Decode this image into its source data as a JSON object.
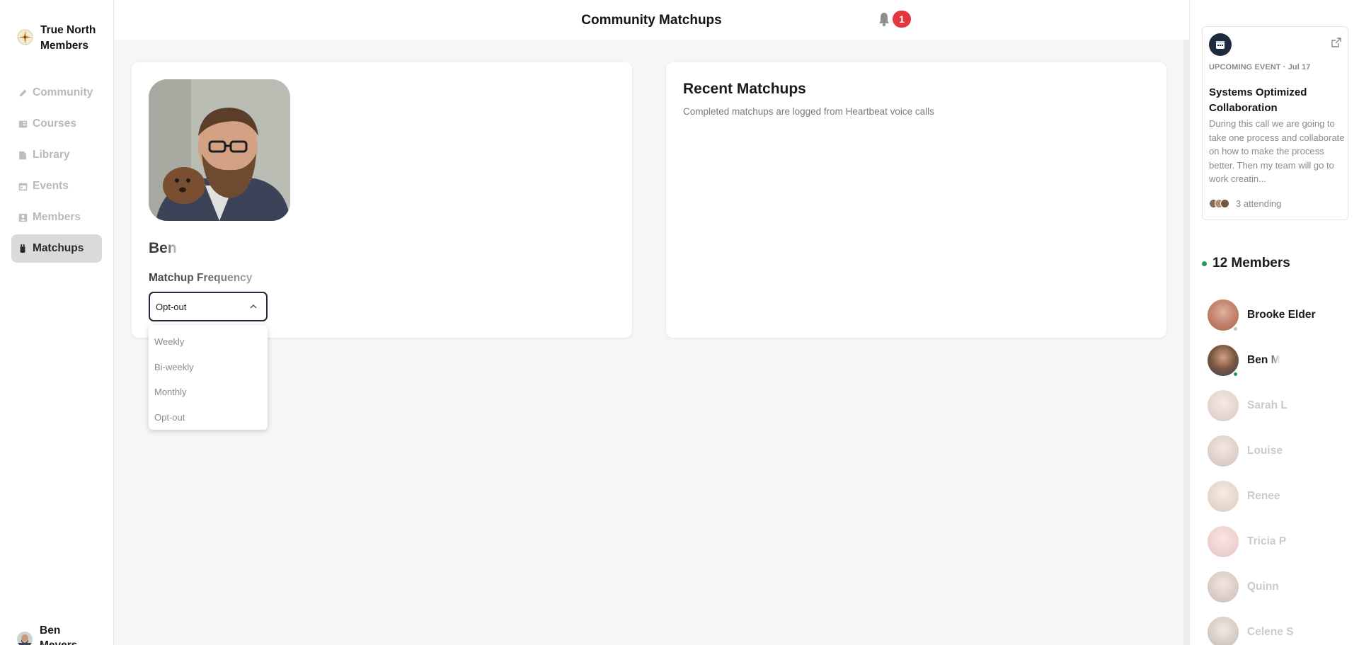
{
  "app": {
    "brand_name": "True North Members",
    "page_title": "Community Matchups",
    "notification_count": "1"
  },
  "sidebar": {
    "items": [
      {
        "label": "Community",
        "icon": "pencil-icon",
        "active": false
      },
      {
        "label": "Courses",
        "icon": "book-icon",
        "active": false
      },
      {
        "label": "Library",
        "icon": "file-icon",
        "active": false
      },
      {
        "label": "Events",
        "icon": "calendar-icon",
        "active": false
      },
      {
        "label": "Members",
        "icon": "user-icon",
        "active": false
      },
      {
        "label": "Matchups",
        "icon": "drink-icon",
        "active": true
      }
    ],
    "current_user": "Ben Meyers"
  },
  "profile": {
    "name": "Ben",
    "frequency_label": "Matchup Frequency",
    "frequency_value": "Opt-out",
    "options": [
      "Weekly",
      "Bi-weekly",
      "Monthly",
      "Opt-out"
    ]
  },
  "recent": {
    "title": "Recent Matchups",
    "subtitle": "Completed matchups are logged from Heartbeat voice calls"
  },
  "event": {
    "tag": "UPCOMING EVENT · Jul 17",
    "title": "Systems Optimized Collaboration",
    "description": "During this call we are going to take one process and collaborate on how to make the process better. Then my team will go to work creatin...",
    "attending": "3 attending"
  },
  "members": {
    "heading": "12 Members",
    "list": [
      {
        "name": "Brooke Elder",
        "status": "offline"
      },
      {
        "name": "Ben M",
        "status": "online"
      },
      {
        "name": "Sarah L",
        "status": "none"
      },
      {
        "name": "Louise",
        "status": "none"
      },
      {
        "name": "Renee",
        "status": "none"
      },
      {
        "name": "Tricia P",
        "status": "none"
      },
      {
        "name": "Quinn",
        "status": "none"
      },
      {
        "name": "Celene S",
        "status": "none"
      }
    ]
  },
  "colors": {
    "accent_dark": "#1f2a3a",
    "badge_red": "#e5363f",
    "online_green": "#1f9b57",
    "active_nav_bg": "#dadada"
  }
}
